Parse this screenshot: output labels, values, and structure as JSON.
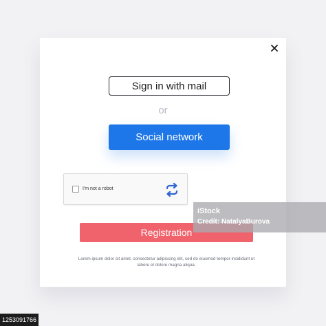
{
  "dialog": {
    "close_icon": "close-icon",
    "sign_in_mail_label": "Sign in with mail",
    "or_label": "or",
    "social_network_label": "Social network",
    "captcha": {
      "label": "I'm not a robot",
      "checked": false,
      "icon": "recaptcha-refresh-icon"
    },
    "registration_label": "Registration",
    "legal_text": "Lorem ipsum dolor sit amet, consectetur adipiscing elit, sed do eiusmod tempor incididunt ut labore et dolore magna aliqua."
  },
  "watermark": {
    "brand": "iStock",
    "credit": "Credit: NatalyaBurova",
    "image_id": "1253091766"
  },
  "colors": {
    "page_bg": "#f2f2f5",
    "social_button": "#1e77e8",
    "registration_button": "#f0626c",
    "outline_button_border": "#2b2b33",
    "captcha_icon_blue": "#2f66d0",
    "or_text": "#b9bcc6"
  }
}
